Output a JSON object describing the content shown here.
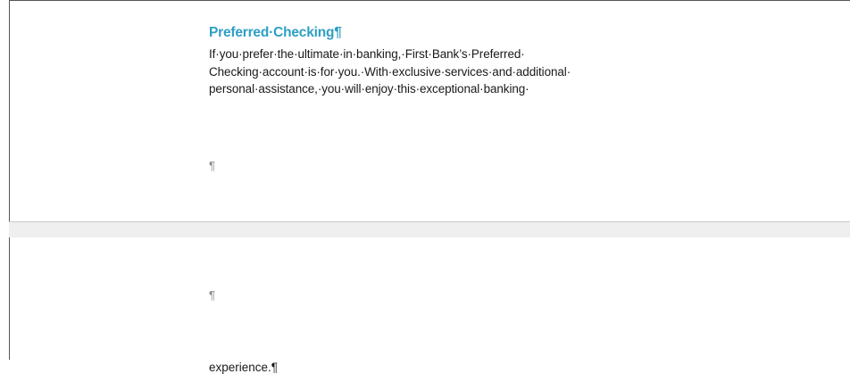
{
  "document": {
    "heading": "Preferred·Checking",
    "heading_mark": "¶",
    "lines": [
      "If·you·prefer·the·ultimate·in·banking,·First·Bank’s·Preferred·",
      "Checking·account·is·for·you.·With·exclusive·services·and·additional·",
      "personal·assistance,·you·will·enjoy·this·exceptional·banking·"
    ],
    "empty_paragraph_mark_1": "¶",
    "empty_paragraph_mark_2": "¶",
    "continued_line": "experience.",
    "continued_line_mark": "¶"
  },
  "colors": {
    "heading": "#2e9fc4",
    "body_text": "#1a1a1a",
    "formatting_marks": "#8a8a8a",
    "page_gap": "#efefef"
  }
}
